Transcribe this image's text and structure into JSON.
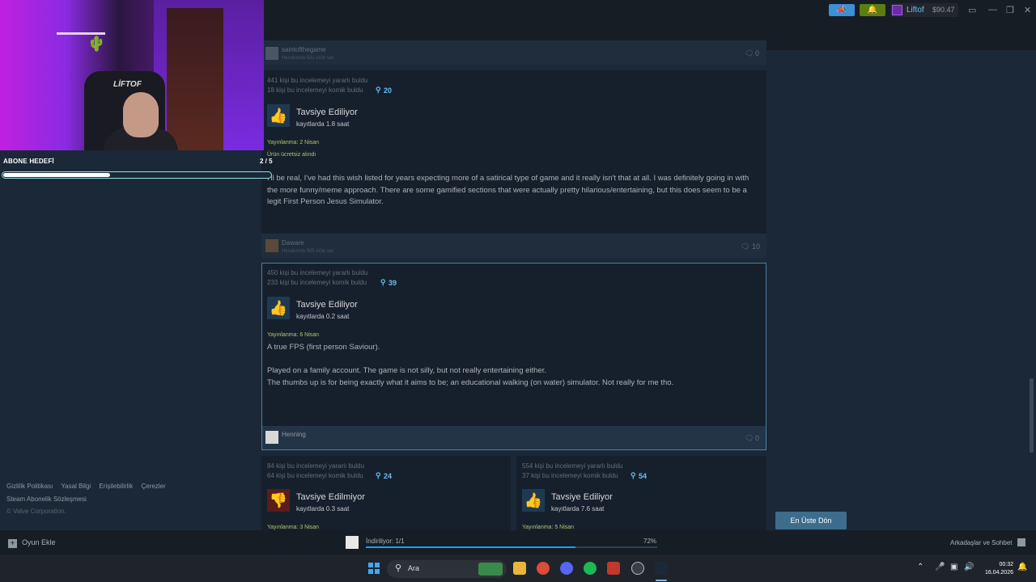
{
  "topbar": {
    "account_name": "Liftof",
    "balance": "$90.47"
  },
  "overlay": {
    "chair_brand": "LİFTOF",
    "goal_label": "ABONE HEDEFİ",
    "goal_count": "2 / 5",
    "goal_progress": 0.4
  },
  "reviews": [
    {
      "id": "r0",
      "author": "saintofthegame",
      "author_sub": "Hesabında 531 ürün var",
      "comments": "0"
    },
    {
      "id": "r1",
      "helpful": "441 kişi bu incelemeyi yararlı buldu",
      "funny": "18 kişi bu incelemeyi komik buldu",
      "awards": "20",
      "verdict": "Tavsiye Ediliyor",
      "hours": "kayıtlarda 1.8 saat",
      "posted": "Yayınlanma: 2 Nisan",
      "received": "Ürün ücretsiz alındı",
      "body": "I'll be real, I've had this wish listed for years expecting more of a satirical type of game and it really isn't that at all. I was definitely going in with the more funny/meme approach. There are some gamified sections that were actually pretty hilarious/entertaining, but this does seem to be a legit First Person Jesus Simulator.",
      "author": "Daware",
      "author_sub": "Hesabında 995 ürün var",
      "comments": "10"
    },
    {
      "id": "r2",
      "helpful": "450 kişi bu incelemeyi yararlı buldu",
      "funny": "233 kişi bu incelemeyi komik buldu",
      "awards": "39",
      "verdict": "Tavsiye Ediliyor",
      "hours": "kayıtlarda 0.2 saat",
      "posted": "Yayınlanma: 6 Nisan",
      "body1": "A true FPS (first person Saviour).",
      "body2": "Played on a family account. The game is not silly, but not really entertaining either.",
      "body3": "The thumbs up is for being exactly what it aims to be; an educational walking (on water) simulator. Not really for me tho.",
      "author": "Henning",
      "comments": "0"
    },
    {
      "id": "r3",
      "helpful": "84 kişi bu incelemeyi yararlı buldu",
      "funny": "64 kişi bu incelemeyi komik buldu",
      "awards": "24",
      "verdict": "Tavsiye Edilmiyor",
      "hours": "kayıtlarda 0.3 saat",
      "posted": "Yayınlanma: 3 Nisan"
    },
    {
      "id": "r4",
      "helpful": "554 kişi bu incelemeyi yararlı buldu",
      "funny": "37 kişi bu incelemeyi komik buldu",
      "awards": "54",
      "verdict": "Tavsiye Ediliyor",
      "hours": "kayıtlarda 7.6 saat",
      "posted": "Yayınlanma: 5 Nisan"
    }
  ],
  "footer": {
    "privacy": "Gizlilik Politikası",
    "legal": "Yasal Bilgi",
    "accessibility": "Erişilebilirlik",
    "cookies": "Çerezler",
    "subscriber_agreement": "Steam Abonelik Sözleşmesi",
    "copyright": "© Valve Corporation."
  },
  "to_top_label": "En Üste Dön",
  "downloads": {
    "add_game": "Oyun Ekle",
    "label": "İndiriliyor: 1/1",
    "percent_text": "72%",
    "progress": 0.72,
    "friends": "Arkadaşlar ve Sohbet"
  },
  "taskbar": {
    "search_placeholder": "Ara",
    "time": "00:32",
    "date": "16.04.2026"
  },
  "colors": {
    "steam_bg": "#1b2838",
    "accent_blue": "#66c0f4",
    "positive": "#66c0f4",
    "negative": "#d6424a"
  },
  "icons": [
    "megaphone-icon",
    "bell-icon",
    "monitor-icon",
    "minimize-icon",
    "restore-icon",
    "close-icon",
    "comment-icon",
    "award-icon",
    "thumbs-up-icon",
    "thumbs-down-icon",
    "plus-icon",
    "chat-icon",
    "windows-start-icon",
    "search-icon"
  ]
}
